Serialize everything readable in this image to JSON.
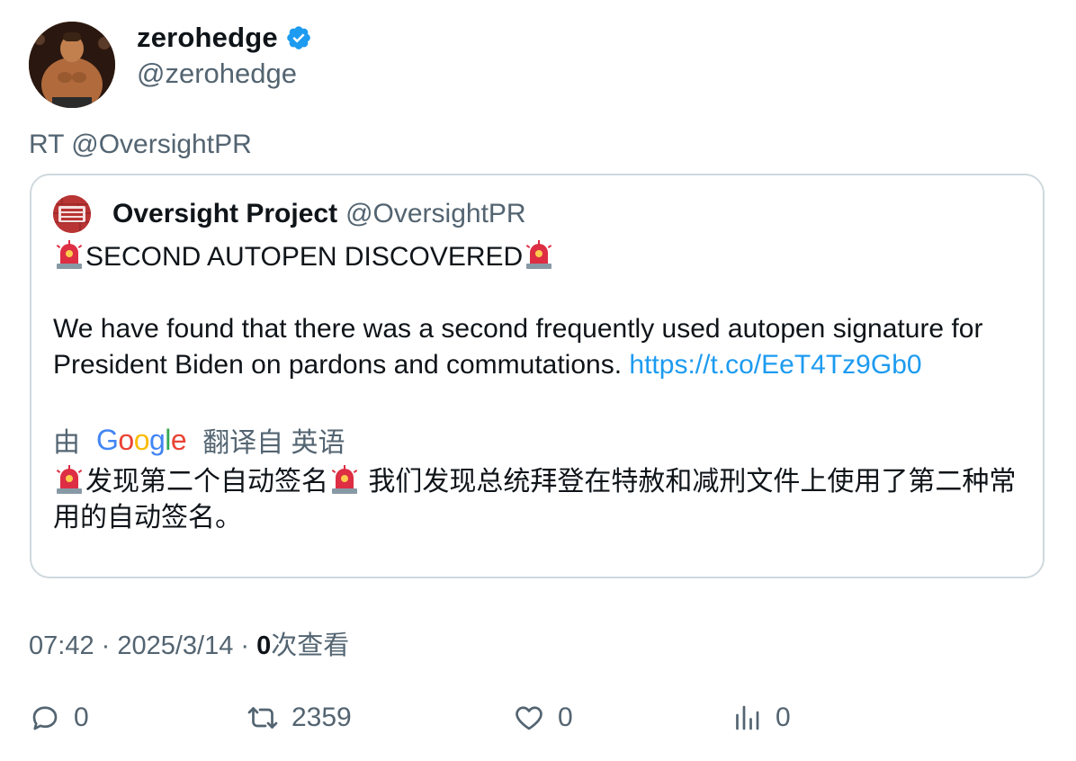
{
  "author": {
    "display_name": "zerohedge",
    "handle": "@zerohedge",
    "verified": true,
    "avatar_icon": "avatar-photo"
  },
  "retweet_label": "RT @OversightPR",
  "quote": {
    "display_name": "Oversight Project",
    "handle": "@OversightPR",
    "avatar_text": "The Oversight Project",
    "headline": "SECOND AUTOPEN DISCOVERED",
    "body": "We have found that there was a second frequently used autopen signature for President Biden on pardons and commutations.",
    "link": "https://t.co/EeT4Tz9Gb0",
    "translate_prefix": "由",
    "translate_brand": "Google",
    "translate_suffix": "翻译自 英语",
    "translated_headline": "发现第二个自动签名",
    "translated_body": "我们发现总统拜登在特赦和减刑文件上使用了第二种常用的自动签名。"
  },
  "meta": {
    "time": "07:42",
    "separator1": " · ",
    "date": "2025/3/14",
    "separator2": " · ",
    "views_count": "0",
    "views_label": "次查看"
  },
  "actions": {
    "reply_count": "0",
    "retweet_count": "2359",
    "like_count": "0",
    "views_count": "0"
  },
  "colors": {
    "accent": "#1d9bf0",
    "muted": "#536471",
    "border": "#cfd9de"
  }
}
